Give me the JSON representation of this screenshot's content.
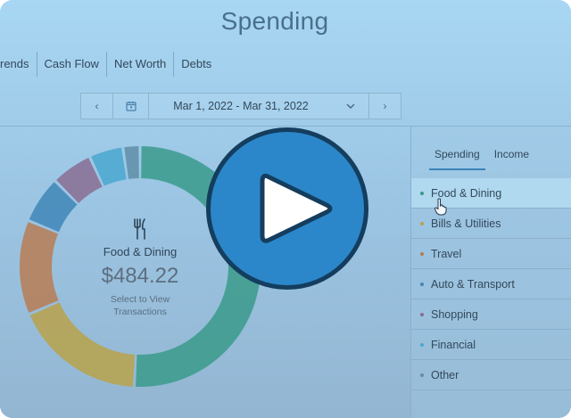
{
  "header": {
    "title": "Spending"
  },
  "nav": {
    "items": [
      "rends",
      "Cash Flow",
      "Net Worth",
      "Debts"
    ]
  },
  "date_range": {
    "label": "Mar 1, 2022 - Mar 31, 2022",
    "prev_icon": "chevron-left-icon",
    "next_icon": "chevron-right-icon"
  },
  "chart": {
    "selected_name": "Food & Dining",
    "selected_amount": "$484.22",
    "hint_line1": "Select to View",
    "hint_line2": "Transactions"
  },
  "chart_data": {
    "type": "pie",
    "categories": [
      "Food & Dining",
      "Bills & Utilities",
      "Travel",
      "Auto & Transport",
      "Shopping",
      "Financial",
      "Other"
    ],
    "values": [
      484.22,
      169.48,
      121.06,
      60.53,
      53.26,
      43.58,
      21.79
    ],
    "colors": [
      "#3a9a8b",
      "#b9a24a",
      "#b77c54",
      "#3f86b7",
      "#8a6d93",
      "#4aa7cf",
      "#5f8ea8"
    ]
  },
  "sidebar": {
    "tabs": [
      "Spending",
      "Income"
    ],
    "active_tab": "Spending",
    "categories": [
      {
        "label": "Food & Dining",
        "color": "#3a9a8b"
      },
      {
        "label": "Bills & Utilities",
        "color": "#b9a24a"
      },
      {
        "label": "Travel",
        "color": "#b77c54"
      },
      {
        "label": "Auto & Transport",
        "color": "#3f86b7"
      },
      {
        "label": "Shopping",
        "color": "#8a6d93"
      },
      {
        "label": "Financial",
        "color": "#4aa7cf"
      },
      {
        "label": "Other",
        "color": "#5f8ea8"
      }
    ]
  },
  "overlay": {
    "icon": "play-icon"
  }
}
